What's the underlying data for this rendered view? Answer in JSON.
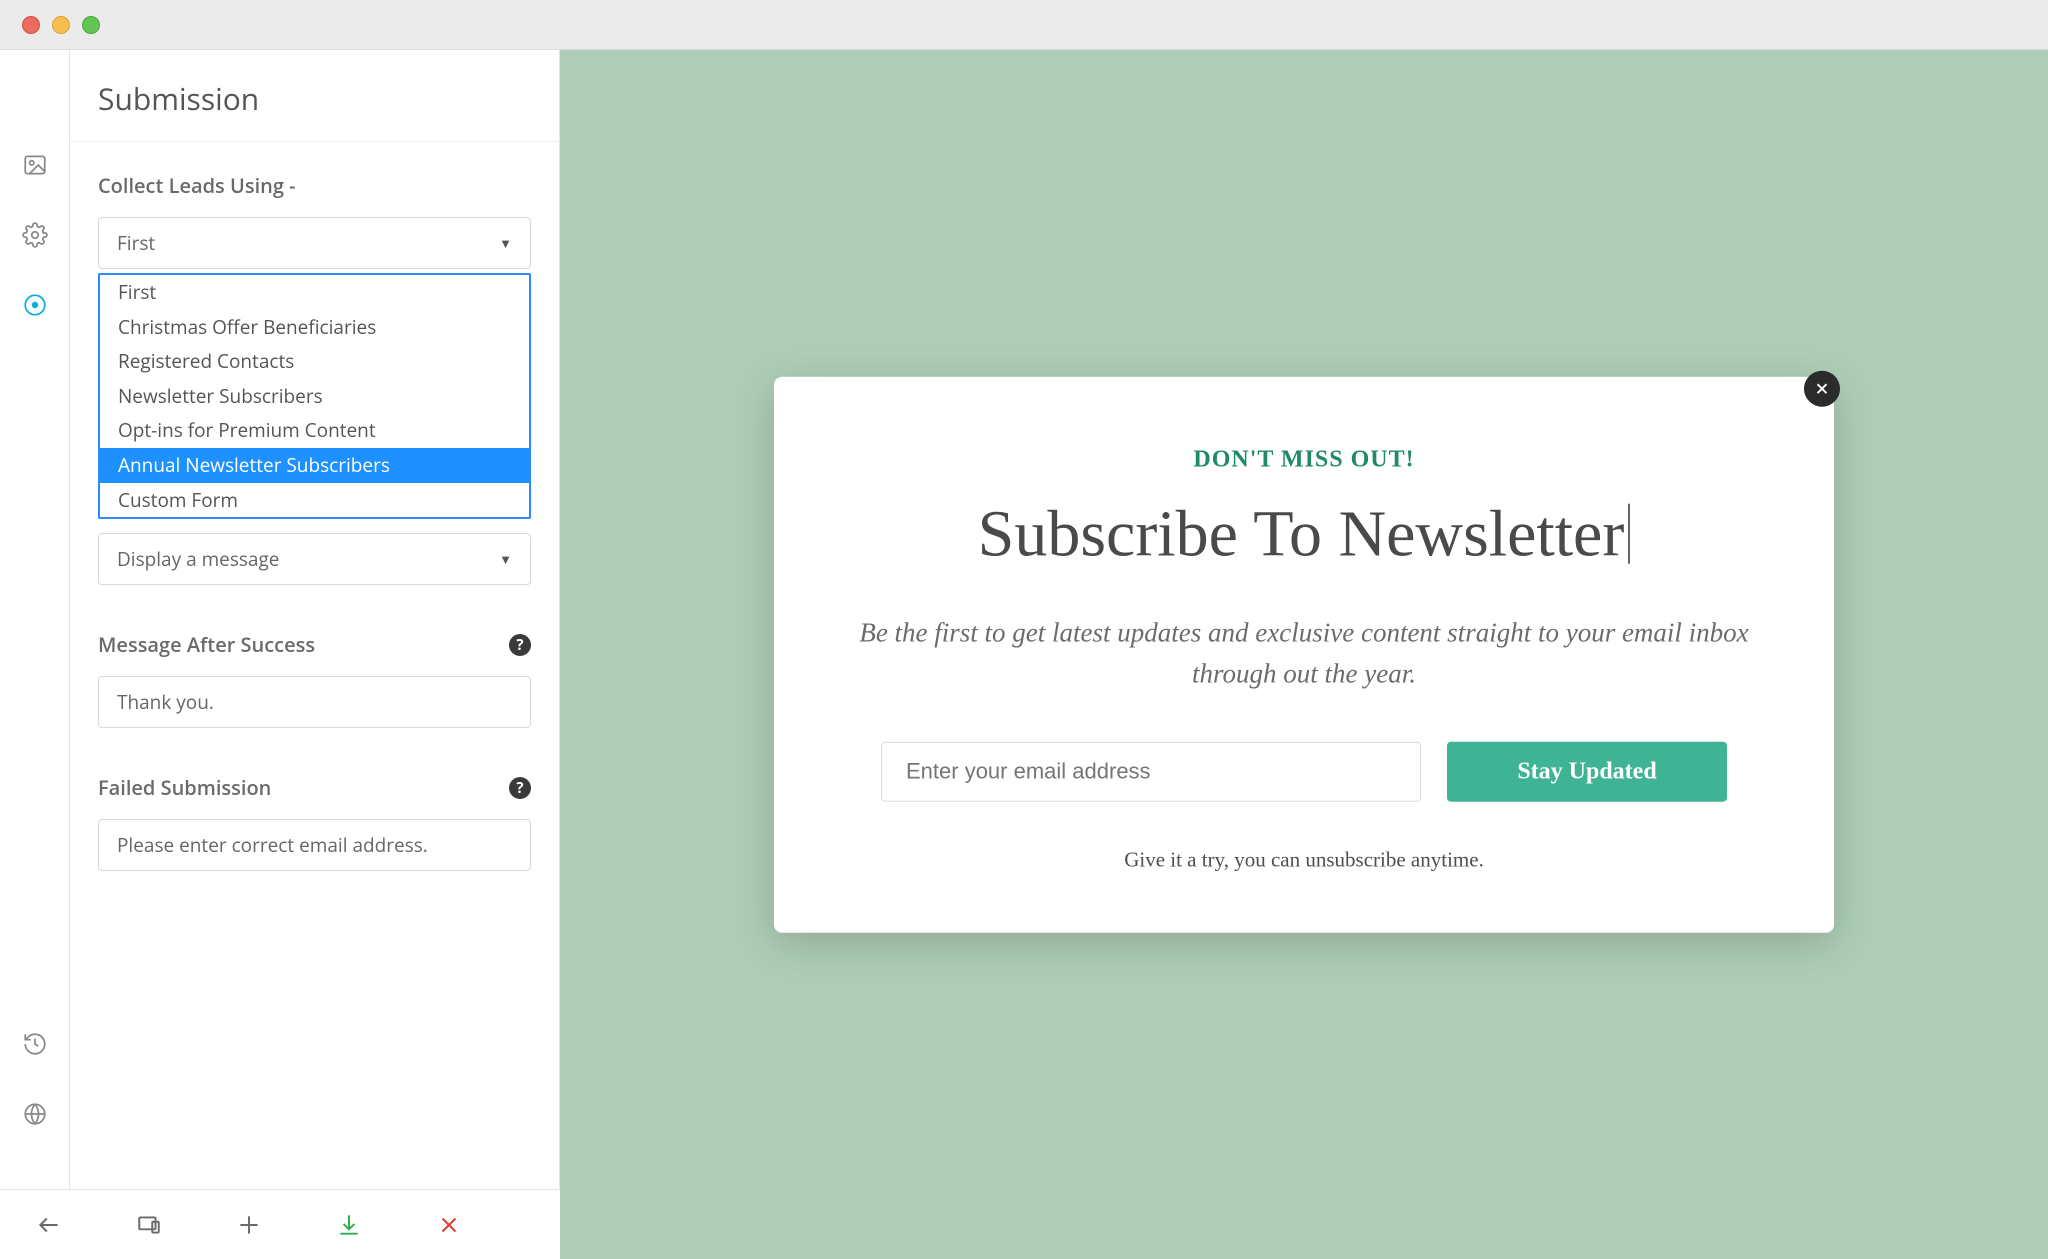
{
  "colors": {
    "canvas_bg": "#aecdb6",
    "accent_green": "#3fb494",
    "accent_text_green": "#1f8a65",
    "active_rail": "#06b0d7"
  },
  "panel": {
    "title": "Submission",
    "collect_label": "Collect Leads Using -",
    "collect_selected": "First",
    "collect_options": [
      "First",
      "Christmas Offer Beneficiaries",
      "Registered Contacts",
      "Newsletter Subscribers",
      "Opt-ins for Premium Content",
      "Annual Newsletter Subscribers",
      "Custom Form"
    ],
    "collect_highlighted_index": 5,
    "after_submit_selected": "Display a message",
    "success_label": "Message After Success",
    "success_value": "Thank you.",
    "failed_label": "Failed Submission",
    "failed_value": "Please enter correct email address."
  },
  "popup": {
    "eyebrow": "DON'T MISS OUT!",
    "headline": "Subscribe To Newsletter",
    "subhead": "Be the first to get latest updates and exclusive content straight to your email inbox through out the year.",
    "email_placeholder": "Enter your email address",
    "cta": "Stay Updated",
    "footnote": "Give it a try, you can unsubscribe anytime."
  }
}
